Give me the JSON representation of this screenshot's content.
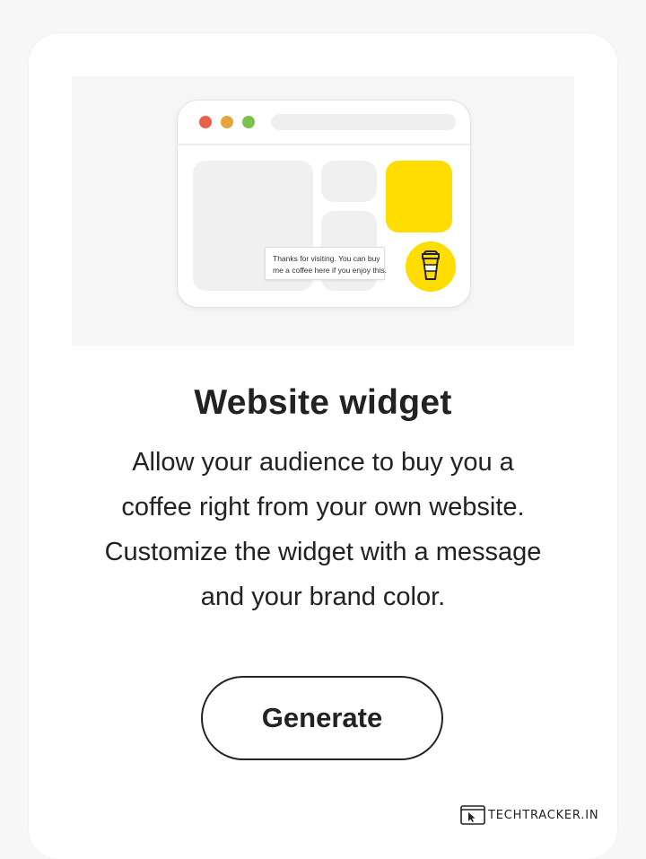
{
  "colors": {
    "accent_yellow": "#ffdd00",
    "text": "#222222",
    "dot_red": "#e8614a",
    "dot_orange": "#e6a43a",
    "dot_green": "#7cc24a"
  },
  "illustration": {
    "tooltip_line1": "Thanks for visiting. You can buy",
    "tooltip_line2": "me a coffee here if you enjoy this.",
    "cup_icon": "coffee-cup-icon"
  },
  "card": {
    "title": "Website widget",
    "description_lines": [
      "Allow your audience to buy you a",
      "coffee right from your own website.",
      "Customize the widget with a message",
      "and your brand color."
    ],
    "button_label": "Generate"
  },
  "watermark": {
    "icon": "browser-cursor-icon",
    "text": "TECHTRACKER.IN"
  }
}
